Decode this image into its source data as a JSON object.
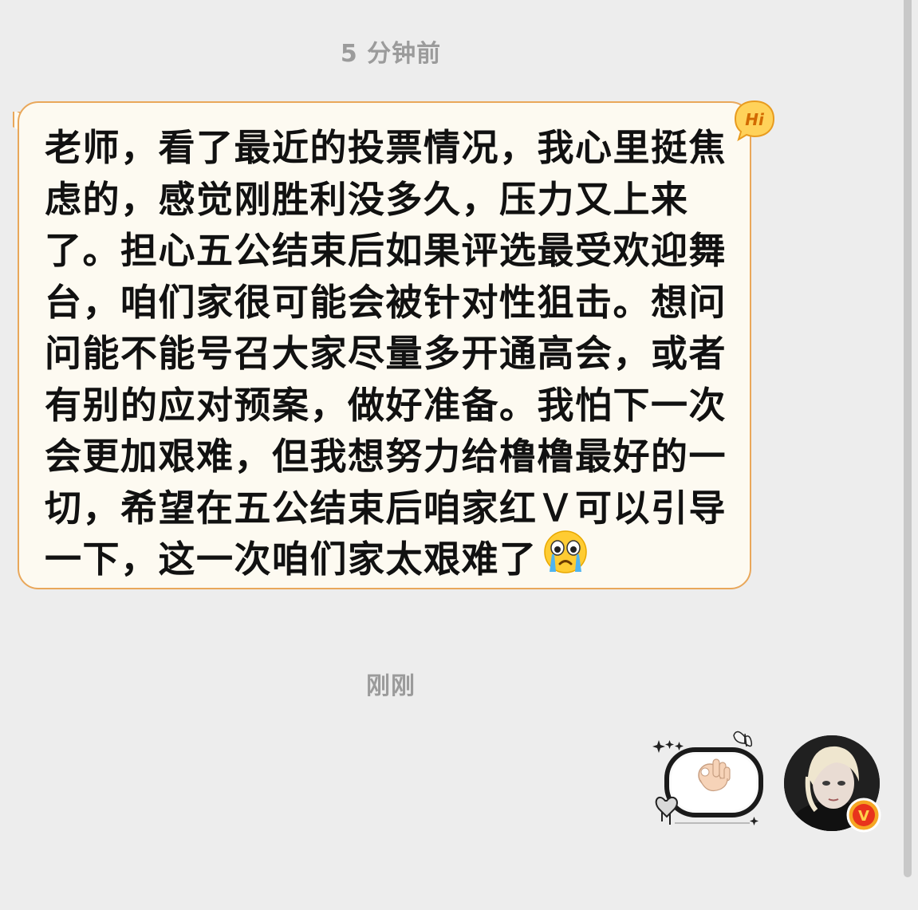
{
  "chat": {
    "timestamps": [
      "5 分钟前",
      "刚刚"
    ],
    "incoming_message": {
      "text": "老师，看了最近的投票情况，我心里挺焦虑的，感觉刚胜利没多久，压力又上来了。担心五公结束后如果评选最受欢迎舞台，咱们家很可能会被针对性狙击。想问问能不能号召大家尽量多开通高会，或者有别的应对预案，做好准备。我怕下一次会更加艰难，但我想努力给橹橹最好的一切，希望在五公结束后咱家红Ｖ可以引导一下，这一次咱们家太艰难了",
      "emoji": "crying-face",
      "bubble_badge": "Hi"
    },
    "outgoing_message": {
      "sticker": "ok-hand-emoji"
    },
    "avatar": {
      "badge": "V"
    }
  },
  "colors": {
    "background": "#ededed",
    "bubble_fill": "#fdfaf1",
    "bubble_border": "#e9a75a",
    "timestamp_text": "#9b9b9b",
    "verified_badge": "#f5a623",
    "verified_badge_inner": "#e8331c"
  }
}
